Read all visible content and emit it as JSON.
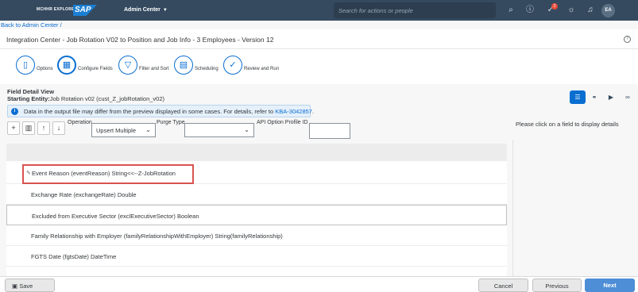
{
  "shell": {
    "brand": "MCHHR EXPLORE",
    "sap_logo": "SAP",
    "app_title": "Admin Center",
    "search_placeholder": "Search for actions or people",
    "notification_count": "2",
    "avatar_initials": "EA",
    "icons": [
      "search-icon",
      "help-icon",
      "approvals-icon",
      "ideas-icon",
      "notifications-icon"
    ]
  },
  "breadcrumb": "Back to Admin Center /",
  "page": {
    "title": "Integration Center - Job Rotation V02 to Position and Job Info - 3 Employees - Version 12"
  },
  "steps": [
    {
      "label": "Options",
      "icon": "document-icon"
    },
    {
      "label": "Configure Fields",
      "icon": "grid-icon"
    },
    {
      "label": "Filter and Sort",
      "icon": "filter-icon"
    },
    {
      "label": "Scheduling",
      "icon": "calendar-icon"
    },
    {
      "label": "Review and Run",
      "icon": "check-icon"
    }
  ],
  "field_detail": {
    "heading": "Field Detail View",
    "entity_label": "Starting Entity:",
    "entity_value": "Job Rotation v02 (cust_Z_jobRotation_v02)"
  },
  "info": {
    "text": "Data in the output file may differ from the preview displayed in some cases. For details, refer to ",
    "link": "KBA-3042857",
    "suffix": "."
  },
  "toolbar": {
    "operation_label": "Operation",
    "operation_value": "Upsert Multiple",
    "purge_label": "Purge Type",
    "purge_value": "",
    "api_label": "API Option Profile ID",
    "api_value": ""
  },
  "side_hint": "Please click on a field to display details",
  "rows": [
    {
      "text": "Event Reason (eventReason) String<<--Z-JobRotation"
    },
    {
      "text": "Exchange Rate (exchangeRate) Double"
    },
    {
      "text": "Excluded from Executive Sector (exclExecutiveSector) Boolean"
    },
    {
      "text": "Family Relationship with Employer (familyRelationshipWithEmployer) String(familyRelationship)"
    },
    {
      "text": "FGTS Date (fgtsDate) DateTime"
    }
  ],
  "footer": {
    "save": "Save",
    "cancel": "Cancel",
    "previous": "Previous",
    "next": "Next"
  },
  "colors": {
    "shell": "#354a5f",
    "accent": "#0a6ed1",
    "highlight_border": "#d9534f"
  }
}
